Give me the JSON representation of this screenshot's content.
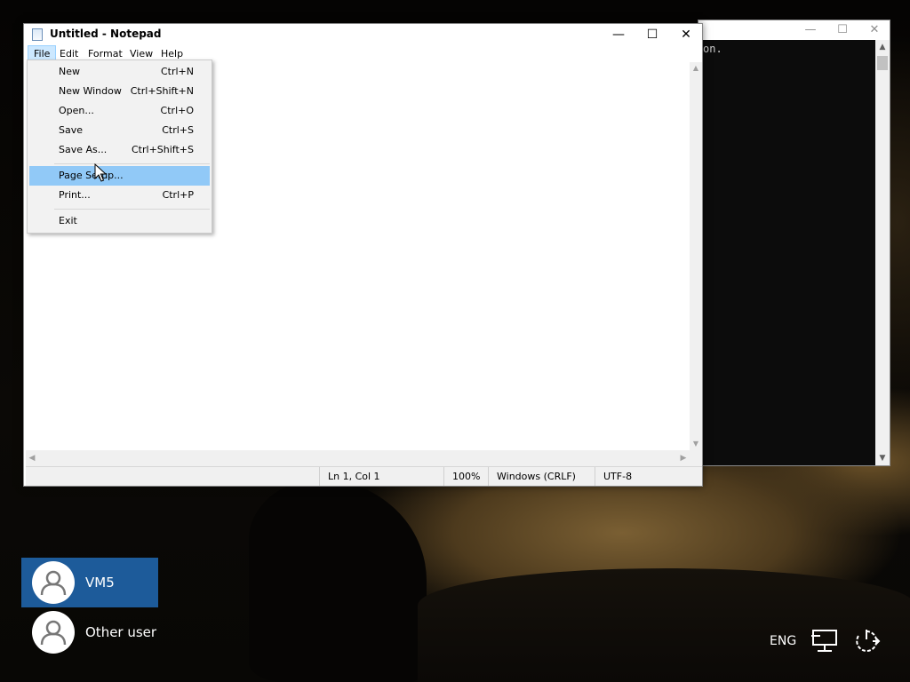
{
  "console": {
    "visible_text": "on.",
    "controls": {
      "minimize": "—",
      "maximize": "☐",
      "close": "✕"
    }
  },
  "notepad": {
    "title": "Untitled - Notepad",
    "controls": {
      "minimize": "—",
      "maximize": "☐",
      "close": "✕"
    },
    "menubar": [
      "File",
      "Edit",
      "Format",
      "View",
      "Help"
    ],
    "status": {
      "position": "Ln 1, Col 1",
      "zoom": "100%",
      "line_ending": "Windows (CRLF)",
      "encoding": "UTF-8"
    }
  },
  "file_menu": {
    "items": [
      {
        "label": "New",
        "shortcut": "Ctrl+N"
      },
      {
        "label": "New Window",
        "shortcut": "Ctrl+Shift+N"
      },
      {
        "label": "Open...",
        "shortcut": "Ctrl+O"
      },
      {
        "label": "Save",
        "shortcut": "Ctrl+S"
      },
      {
        "label": "Save As...",
        "shortcut": "Ctrl+Shift+S"
      },
      {
        "label": "Page Setup...",
        "shortcut": "",
        "highlighted": true
      },
      {
        "label": "Print...",
        "shortcut": "Ctrl+P"
      },
      {
        "label": "Exit",
        "shortcut": ""
      }
    ]
  },
  "login": {
    "users": [
      {
        "name": "VM5",
        "selected": true
      },
      {
        "name": "Other user",
        "selected": false
      }
    ],
    "language": "ENG",
    "icons": [
      "network-icon",
      "power-icon"
    ]
  },
  "colors": {
    "menu_highlight": "#91c9f7",
    "selected_user": "#1d5b9a"
  }
}
